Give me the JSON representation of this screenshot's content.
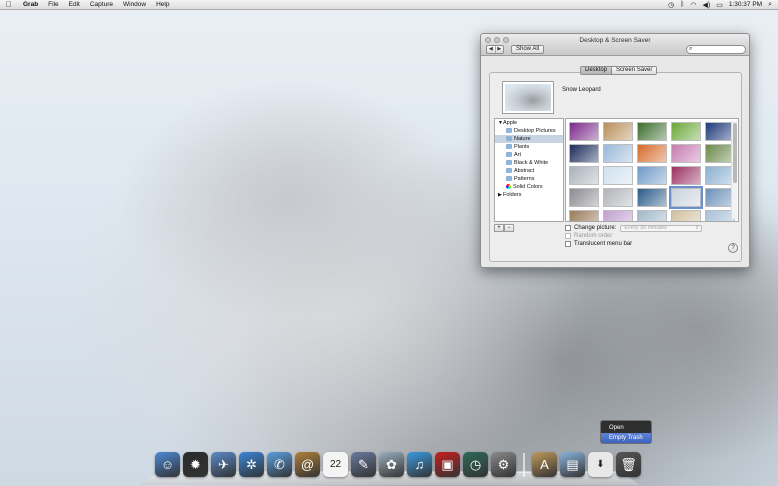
{
  "menubar": {
    "app": "Grab",
    "items": [
      "File",
      "Edit",
      "Capture",
      "Window",
      "Help"
    ],
    "clock": "1:30:37 PM"
  },
  "window": {
    "title": "Desktop & Screen Saver",
    "show_all": "Show All",
    "search_placeholder": "",
    "tabs": [
      {
        "label": "Desktop",
        "active": true
      },
      {
        "label": "Screen Saver",
        "active": false
      }
    ],
    "current_wallpaper": "Snow Leopard",
    "sources": [
      {
        "label": "Apple",
        "level": 0,
        "type": "group"
      },
      {
        "label": "Desktop Pictures",
        "level": 1,
        "type": "folder"
      },
      {
        "label": "Nature",
        "level": 1,
        "type": "folder",
        "selected": true
      },
      {
        "label": "Plants",
        "level": 1,
        "type": "folder"
      },
      {
        "label": "Art",
        "level": 1,
        "type": "folder"
      },
      {
        "label": "Black & White",
        "level": 1,
        "type": "folder"
      },
      {
        "label": "Abstract",
        "level": 1,
        "type": "folder"
      },
      {
        "label": "Patterns",
        "level": 1,
        "type": "folder"
      },
      {
        "label": "Solid Colors",
        "level": 1,
        "type": "colors"
      },
      {
        "label": "Folders",
        "level": 0,
        "type": "group"
      }
    ],
    "add_label": "+",
    "remove_label": "−",
    "thumbnails": [
      "#7a2a8a",
      "#b98f5a",
      "#3c6e2c",
      "#6aa838",
      "#1f3a7a",
      "#1a2a5a",
      "#9ab8d8",
      "#d66a2a",
      "#c67ab0",
      "#6a8a4a",
      "#aab2ba",
      "#cfe0ee",
      "#6f9ac8",
      "#9a3060",
      "#8ab0d0",
      "#8a8a90",
      "#b0b4b8",
      "#2a5a8a",
      "#c8d2dc",
      "#6a90b8",
      "#9a7a5a",
      "#c0a0d0",
      "#a0b8c8",
      "#d0c0a0",
      "#a8c0d8"
    ],
    "selected_thumbnail": 18,
    "change_picture_label": "Change picture:",
    "interval": "Every 30 minutes",
    "random_order_label": "Random order",
    "translucent_menu_label": "Translucent menu bar",
    "help_label": "?"
  },
  "context_menu": {
    "items": [
      {
        "label": "Open",
        "highlighted": false
      },
      {
        "label": "Empty Trash",
        "highlighted": true
      }
    ]
  },
  "dock": {
    "apps": [
      {
        "name": "finder-icon",
        "glyph": "☺",
        "color": "#4d8ad6"
      },
      {
        "name": "dashboard-icon",
        "glyph": "✹",
        "color": "#2b2b2b"
      },
      {
        "name": "mail-icon",
        "glyph": "✈",
        "color": "#5a8ac8"
      },
      {
        "name": "safari-icon",
        "glyph": "✲",
        "color": "#3a86d8"
      },
      {
        "name": "ichat-icon",
        "glyph": "✆",
        "color": "#5aa0e0"
      },
      {
        "name": "address-book-icon",
        "glyph": "@",
        "color": "#b0803a"
      },
      {
        "name": "ical-icon",
        "glyph": "22",
        "color": "#f4f4f4"
      },
      {
        "name": "preview-icon",
        "glyph": "✎",
        "color": "#6a7aa0"
      },
      {
        "name": "iphoto-icon",
        "glyph": "✿",
        "color": "#9ab0c0"
      },
      {
        "name": "itunes-icon",
        "glyph": "♫",
        "color": "#3a9ae0"
      },
      {
        "name": "photo-booth-icon",
        "glyph": "▣",
        "color": "#c81e1e"
      },
      {
        "name": "time-machine-icon",
        "glyph": "◷",
        "color": "#2e6a58"
      },
      {
        "name": "system-preferences-icon",
        "glyph": "⚙",
        "color": "#8a8a8a"
      }
    ],
    "stacks": [
      {
        "name": "applications-stack-icon",
        "glyph": "A",
        "color": "#c09a5a"
      },
      {
        "name": "documents-folder-icon",
        "glyph": "▤",
        "color": "#8ab4dc"
      },
      {
        "name": "downloads-stack-icon",
        "glyph": "⬇",
        "color": "#e8e8e8"
      },
      {
        "name": "trash-icon",
        "glyph": "🗑",
        "color": "#555555"
      }
    ]
  }
}
